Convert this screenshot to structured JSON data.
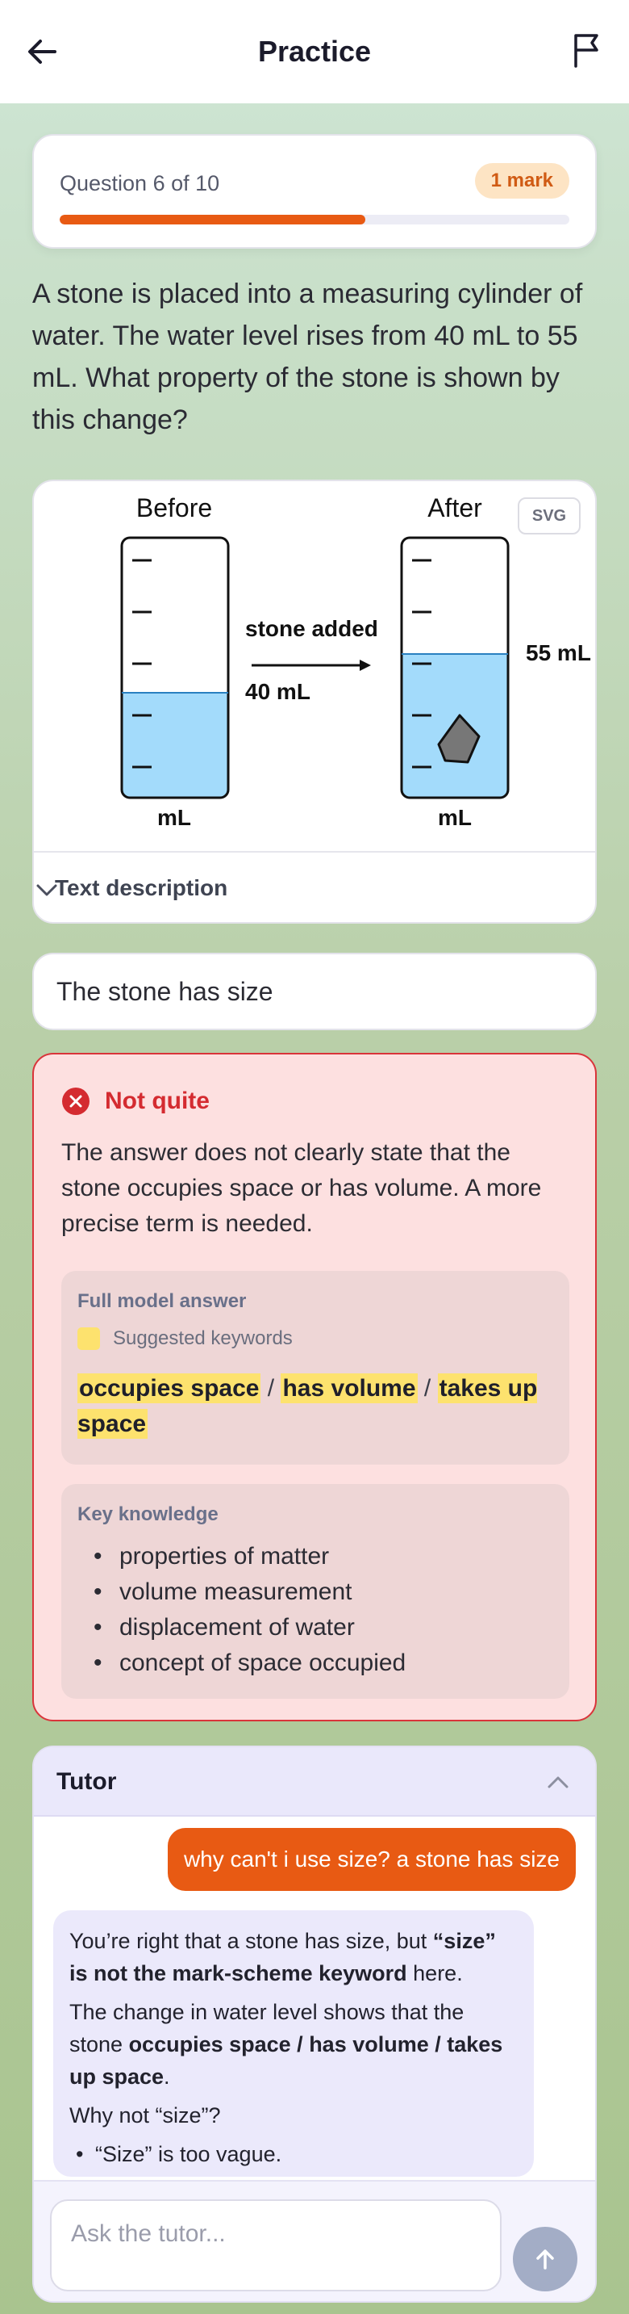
{
  "topbar": {
    "title": "Practice"
  },
  "question_card": {
    "progress_label": "Question 6 of 10",
    "marks": "1 mark",
    "progress_fraction": 0.6
  },
  "question_text": "A stone is placed into a measuring cylinder of water. The water level rises from 40 mL to 55 mL. What property of the stone is shown by this change?",
  "figure": {
    "before_label": "Before",
    "after_label": "After",
    "arrow_label": "stone added",
    "before_level": "40 mL",
    "after_level": "55 mL",
    "unit_left": "mL",
    "unit_right": "mL",
    "svg_badge": "SVG",
    "description_toggle": "Text description"
  },
  "answer": {
    "value": "The stone has size"
  },
  "feedback": {
    "status": "Not quite",
    "message": "The answer does not clearly state that the stone occupies space or has volume. A more precise term is needed.",
    "model_answer_title": "Full model answer",
    "keywords_legend": "Suggested keywords",
    "keywords": [
      "occupies space",
      "has volume",
      "takes up space"
    ],
    "keyword_separator": "/",
    "knowledge_title": "Key knowledge",
    "knowledge": [
      "properties of matter",
      "volume measurement",
      "displacement of water",
      "concept of space occupied"
    ]
  },
  "tutor": {
    "title": "Tutor",
    "user_message": "why can't i use size? a stone has size",
    "bot": {
      "p1_a": "You’re right that a stone has size, but ",
      "p1_b": "“size” is not the mark-scheme keyword",
      "p1_c": " here.",
      "p2_a": "The change in water level shows that the stone ",
      "p2_b": "occupies space",
      "p2_c": " / ",
      "p2_d": "has volume",
      "p2_e": " / ",
      "p2_f": "takes up space",
      "p2_g": ".",
      "p3": "Why not “size”?",
      "bullet1": "“Size” is too vague."
    },
    "input_placeholder": "Ask the tutor..."
  },
  "colors": {
    "accent": "#e85a13",
    "error": "#d42b30",
    "keyword_highlight": "#fde26e",
    "water": "#a3dbfb"
  }
}
